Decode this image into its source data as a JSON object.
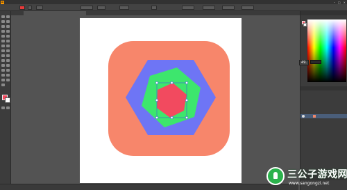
{
  "app": {
    "logo_text": "Ai"
  },
  "colors": {
    "rounded_square": "#f7866b",
    "outer_hexagon": "#6e75f5",
    "middle_hexagon": "#3de66d",
    "inner_hexagon": "#f24a5f",
    "fill_swatch": "#f24a5f"
  },
  "color_panel": {
    "hover_value": "49."
  },
  "watermark": {
    "title": "三公子游戏网",
    "url": "www.sangongzi.net"
  }
}
